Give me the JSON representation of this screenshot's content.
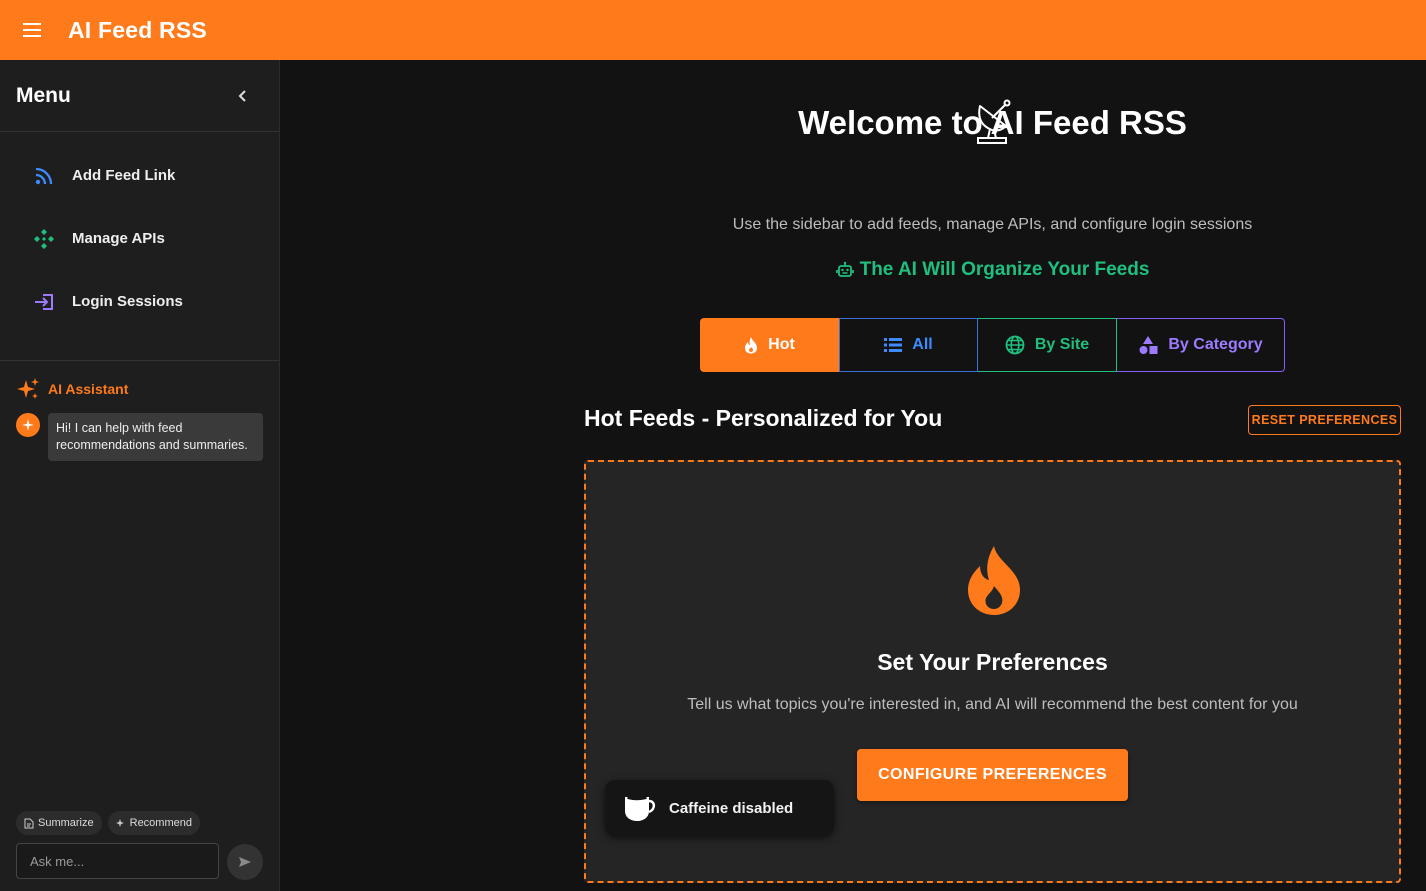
{
  "app": {
    "title": "AI Feed RSS"
  },
  "sidebar": {
    "title": "Menu",
    "items": [
      {
        "label": "Add Feed Link",
        "icon": "rss-icon",
        "color": "#3d8bfd"
      },
      {
        "label": "Manage APIs",
        "icon": "api-icon",
        "color": "#1fbf7e"
      },
      {
        "label": "Login Sessions",
        "icon": "login-icon",
        "color": "#9d7bff"
      }
    ],
    "assistant": {
      "label": "AI Assistant",
      "message": "Hi! I can help with feed recommendations and summaries.",
      "chips": [
        "Summarize",
        "Recommend"
      ],
      "input_placeholder": "Ask me..."
    }
  },
  "main": {
    "welcome": "Welcome to AI Feed RSS",
    "subtitle": "Use the sidebar to add feeds, manage APIs, and configure login sessions",
    "organize": "The AI Will Organize Your Feeds",
    "tabs": [
      {
        "label": "Hot",
        "icon": "flame-icon"
      },
      {
        "label": "All",
        "icon": "list-icon"
      },
      {
        "label": "By Site",
        "icon": "globe-icon"
      },
      {
        "label": "By Category",
        "icon": "category-icon"
      }
    ],
    "section_title": "Hot Feeds - Personalized for You",
    "reset_label": "RESET PREFERENCES",
    "card": {
      "title": "Set Your Preferences",
      "subtitle": "Tell us what topics you're interested in, and AI will recommend the best content for you",
      "button": "CONFIGURE PREFERENCES"
    }
  },
  "toast": {
    "label": "Caffeine disabled",
    "icon": "coffee-cup-icon"
  },
  "colors": {
    "accent": "#ff7a1a",
    "blue": "#3d8bfd",
    "green": "#1fbf7e",
    "purple": "#9d7bff",
    "background": "#121212"
  }
}
